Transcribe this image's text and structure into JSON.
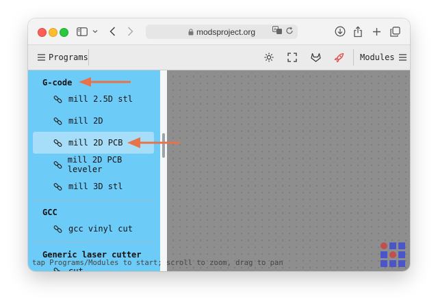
{
  "browser": {
    "url": "modsproject.org",
    "icons": [
      "sidebar-icon",
      "chevron-down-icon",
      "back-icon",
      "forward-icon",
      "lock-icon",
      "translate-icon",
      "reload-icon",
      "download-icon",
      "share-icon",
      "new-tab-icon",
      "tabs-icon"
    ]
  },
  "toolbar": {
    "programs_label": "Programs",
    "modules_label": "Modules",
    "icons": [
      "menu-icon",
      "sun-icon",
      "fullscreen-icon",
      "gitlab-icon",
      "rocket-icon",
      "menu-icon"
    ]
  },
  "sidebar": {
    "sections": [
      {
        "heading": "G-code",
        "items": [
          "mill 2.5D stl",
          "mill 2D",
          "mill 2D PCB",
          "mill 2D PCB leveler",
          "mill 3D stl"
        ]
      },
      {
        "heading": "GCC",
        "items": [
          "gcc vinyl cut"
        ]
      },
      {
        "heading": "Generic laser cutter",
        "items": [
          "cut"
        ]
      }
    ],
    "selected_item": "mill 2D PCB"
  },
  "status_text": "tap Programs/Modules to start; scroll to zoom, drag to pan",
  "colors": {
    "sidebar_bg": "#6ccbf7",
    "canvas_bg": "#8e8e8e",
    "arrow": "#e8734a",
    "logo_red": "#c0504d",
    "logo_blue": "#4a55c9"
  }
}
